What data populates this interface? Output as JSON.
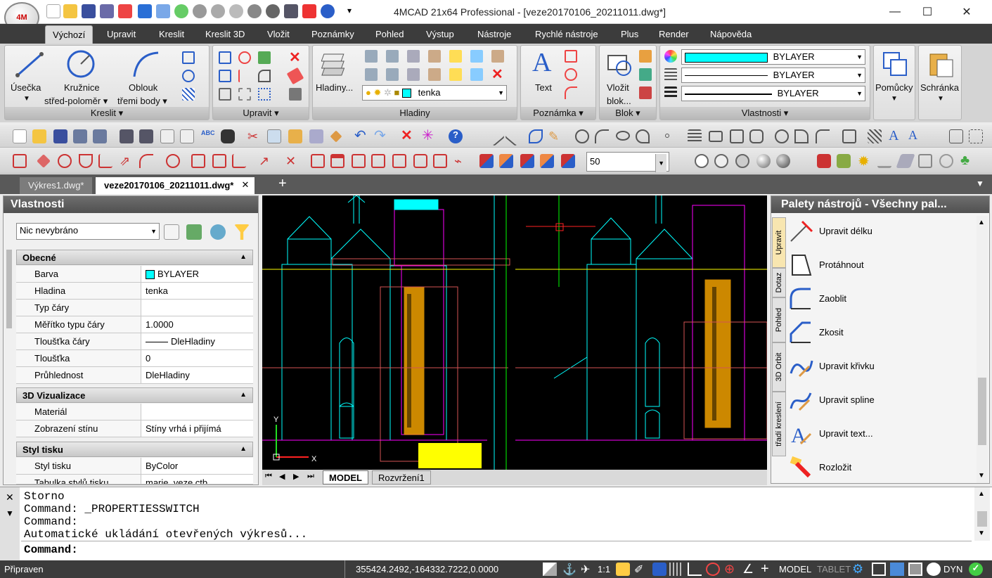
{
  "window": {
    "title": "4MCAD 21x64 Professional - [veze20170106_20211011.dwg*]",
    "minimize": "—",
    "maximize": "☐",
    "close": "✕"
  },
  "logo": "4M",
  "menu": [
    "Výchozí",
    "Upravit",
    "Kreslit",
    "Kreslit 3D",
    "Vložit",
    "Poznámky",
    "Pohled",
    "Výstup",
    "Nástroje",
    "Rychlé nástroje",
    "Plus",
    "Render",
    "Nápověda"
  ],
  "ribbon": {
    "kreslit": {
      "title": "Kreslit ▾",
      "usecka": "Úsečka",
      "kruznice1": "Kružnice",
      "kruznice2": "střed-poloměr ▾",
      "oblouk1": "Oblouk",
      "oblouk2": "třemi body ▾"
    },
    "upravit": {
      "title": "Upravit ▾"
    },
    "hladiny": {
      "title": "Hladiny",
      "button": "Hladiny...",
      "layer_value": "tenka",
      "layer_color": "#00ffff"
    },
    "poznamka": {
      "title": "Poznámka ▾",
      "text": "Text"
    },
    "blok": {
      "title": "Blok ▾",
      "vlozit1": "Vložit",
      "vlozit2": "blok..."
    },
    "vlastnosti": {
      "title": "Vlastnosti ▾",
      "color": "BYLAYER",
      "linetype": "BYLAYER",
      "lineweight": "BYLAYER"
    },
    "pomucky": "Pomůcky",
    "schranka": "Schránka"
  },
  "toolbar2": {
    "scale_value": "50"
  },
  "doc_tabs": [
    "Výkres1.dwg*",
    "veze20170106_20211011.dwg*"
  ],
  "properties": {
    "title": "Vlastnosti",
    "selection": "Nic nevybráno",
    "sections": {
      "obecne": "Obecné",
      "viz3d": "3D Vizualizace",
      "styl": "Styl tisku"
    },
    "rows_general": [
      {
        "name": "Barva",
        "value": "BYLAYER"
      },
      {
        "name": "Hladina",
        "value": "tenka"
      },
      {
        "name": "Typ čáry",
        "value": ""
      },
      {
        "name": "Měřítko typu čáry",
        "value": "1.0000"
      },
      {
        "name": "Tloušťka čáry",
        "value": "DleHladiny"
      },
      {
        "name": "Tloušťka",
        "value": "0"
      },
      {
        "name": "Průhlednost",
        "value": "DleHladiny"
      }
    ],
    "rows_3d": [
      {
        "name": "Materiál",
        "value": ""
      },
      {
        "name": "Zobrazení stínu",
        "value": "Stíny vrhá i přijímá"
      }
    ],
    "rows_print": [
      {
        "name": "Styl tisku",
        "value": "ByColor"
      },
      {
        "name": "Tabulka stylů tisku",
        "value": "marie_veze.ctb"
      }
    ]
  },
  "layout_tabs": {
    "model": "MODEL",
    "layout1": "Rozvržení1"
  },
  "axis": {
    "x": "X",
    "y": "Y"
  },
  "palette": {
    "title": "Palety nástrojů - Všechny pal...",
    "vtabs": [
      "Upravit",
      "Dotaz",
      "Pohled",
      "3D Orbit",
      "třadí kreslení"
    ],
    "tools": [
      "Upravit délku",
      "Protáhnout",
      "Zaoblit",
      "Zkosit",
      "Upravit křivku",
      "Upravit spline",
      "Upravit text...",
      "Rozložit"
    ]
  },
  "command": {
    "lines": [
      "Storno",
      "Command: _PROPERTIESSWITCH",
      "Command:",
      "Automatické ukládání otevřených výkresů..."
    ],
    "prompt": "Command:"
  },
  "status": {
    "left": "Připraven",
    "coords": "355424.2492,-164332.7222,0.0000",
    "scale": "1:1",
    "model": "MODEL",
    "tablet": "TABLET",
    "dyn": "DYN"
  }
}
